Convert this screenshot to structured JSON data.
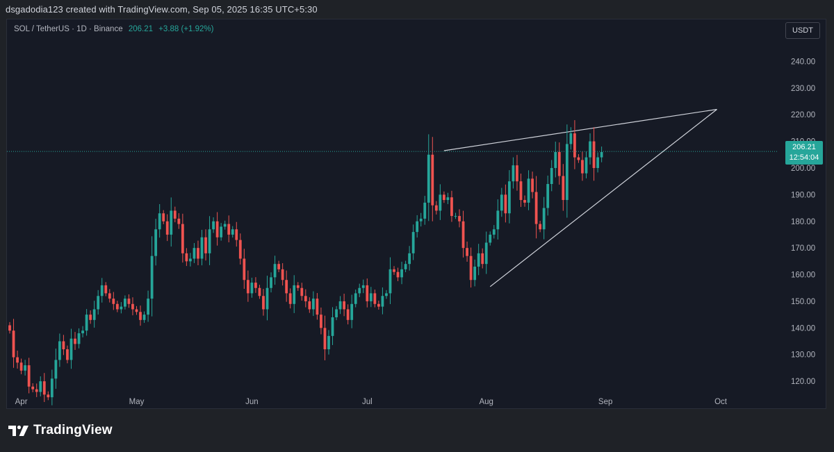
{
  "credit": "dsgadodia123 created with TradingView.com, Sep 05, 2025 16:35 UTC+5:30",
  "header": {
    "symbol": "SOL / TetherUS · 1D · Binance",
    "price": "206.21",
    "change": "+3.88 (+1.92%)",
    "currency_button": "USDT"
  },
  "price_tag": {
    "price": "206.21",
    "countdown": "12:54:04"
  },
  "footer": {
    "brand": "TradingView"
  },
  "colors": {
    "up": "#26a69a",
    "down": "#ef5350",
    "background": "#161a25",
    "trendline": "#d1d4dc",
    "price_line": "#26a69a"
  },
  "icons": {
    "brand": "tradingview-logo-icon"
  },
  "chart_data": {
    "type": "candlestick",
    "x_axis_labels": [
      "Apr",
      "May",
      "Jun",
      "Jul",
      "Aug",
      "Sep",
      "Oct"
    ],
    "y_axis_labels": [
      "240.00",
      "230.00",
      "220.00",
      "210.00",
      "200.00",
      "190.00",
      "180.00",
      "170.00",
      "160.00",
      "150.00",
      "140.00",
      "130.00",
      "120.00"
    ],
    "ylim": [
      113,
      250
    ],
    "grid": false,
    "last_price": 206.21,
    "closes": [
      139,
      129,
      127,
      124,
      126,
      118,
      117,
      116,
      120,
      115,
      114,
      121,
      128,
      135,
      132,
      128,
      136,
      134,
      138,
      139,
      145,
      143,
      147,
      152,
      156,
      153,
      151,
      149,
      147,
      148,
      151,
      149,
      147,
      146,
      143,
      145,
      151,
      167,
      177,
      183,
      180,
      175,
      184,
      181,
      179,
      168,
      165,
      166,
      170,
      166,
      174,
      168,
      177,
      180,
      174,
      178,
      179,
      175,
      177,
      173,
      166,
      158,
      153,
      157,
      155,
      152,
      147,
      155,
      159,
      164,
      162,
      158,
      153,
      149,
      156,
      155,
      152,
      150,
      147,
      151,
      145,
      140,
      132,
      137,
      144,
      147,
      150,
      147,
      143,
      149,
      153,
      155,
      156,
      150,
      153,
      149,
      148,
      152,
      153,
      162,
      161,
      159,
      162,
      164,
      168,
      176,
      180,
      181,
      187,
      205,
      186,
      184,
      190,
      188,
      189,
      182,
      182,
      180,
      170,
      167,
      158,
      163,
      168,
      164,
      172,
      175,
      177,
      184,
      190,
      183,
      195,
      201,
      195,
      188,
      187,
      196,
      191,
      179,
      177,
      185,
      194,
      200,
      206,
      197,
      188,
      209,
      213,
      204,
      203,
      198,
      204,
      210,
      200,
      204,
      206
    ]
  }
}
